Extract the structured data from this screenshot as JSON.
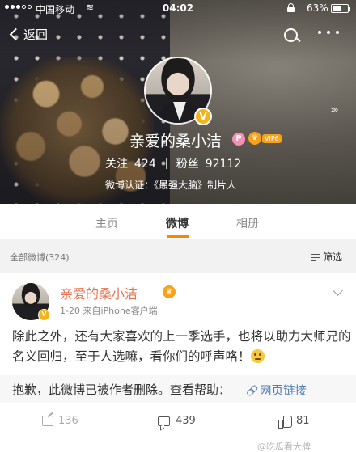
{
  "status_bar": {
    "carrier": "中国移动",
    "wifi_icon": "wifi-icon",
    "time": "04:02",
    "battery_percent": "63%",
    "battery_level": 0.63
  },
  "nav": {
    "back_label": "返回"
  },
  "profile": {
    "name": "亲爱的桑小洁",
    "vip_level": "VIP6",
    "p_badge": "P",
    "v_badge": "V",
    "follow_label": "关注",
    "follow_count": "424",
    "fans_label": "粉丝",
    "fans_count": "92112",
    "verification": "微博认证：《最强大脑》制片人"
  },
  "tabs": [
    {
      "label": "主页",
      "active": false
    },
    {
      "label": "微博",
      "active": true
    },
    {
      "label": "相册",
      "active": false
    }
  ],
  "filter_bar": {
    "all_label": "全部微博(324)",
    "filter_label": "筛选"
  },
  "post": {
    "author": "亲爱的桑小洁",
    "v_badge": "V",
    "meta": "1-20  来自iPhone客户端",
    "text": "除此之外，还有大家喜欢的上一季选手，也将以助力大师兄的名义回归，至于人选嘛，看你们的呼声咯！",
    "repost_text": "抱歉，此微博已被作者删除。查看帮助：",
    "web_link": "网页链接",
    "share_count": "136",
    "comment_count": "439",
    "like_count": "81"
  },
  "watermark": "@吃瓜看大牌",
  "colors": {
    "accent_orange": "#ff8200",
    "name_color": "#eb7350",
    "link_color": "#507daf",
    "verified_gold": "#f6b21b"
  }
}
